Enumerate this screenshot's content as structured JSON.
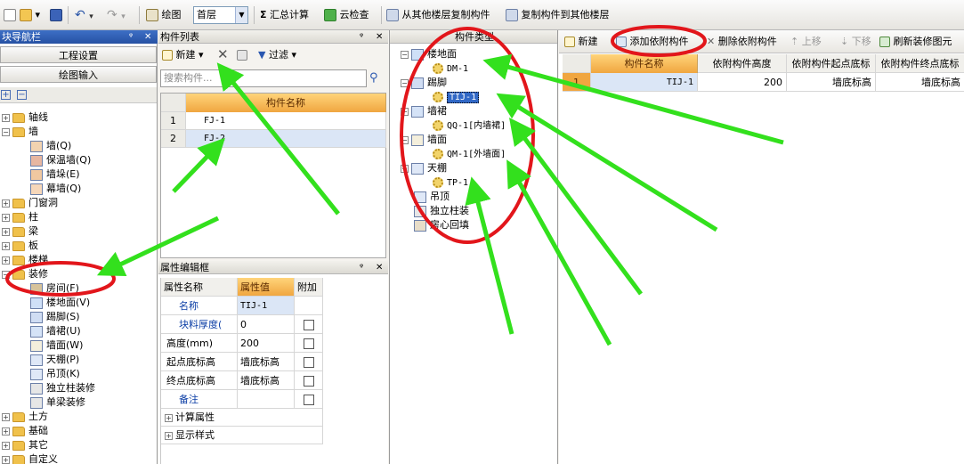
{
  "toolbar": {
    "draw_label": "绘图",
    "floor_value": "首层",
    "sum_label": "汇总计算",
    "cloud_check_label": "云检查",
    "copy_from_label": "从其他楼层复制构件",
    "copy_to_label": "复制构件到其他楼层"
  },
  "nav": {
    "title": "块导航栏",
    "project_settings": "工程设置",
    "draw_input": "绘图输入",
    "tree": [
      {
        "label": "轴线",
        "level": 0,
        "expander": "+",
        "icon": "folder-icon"
      },
      {
        "label": "墙",
        "level": 0,
        "expander": "-",
        "icon": "folder-icon"
      },
      {
        "label": "墙(Q)",
        "level": 1,
        "icon": "wall-icon"
      },
      {
        "label": "保温墙(Q)",
        "level": 1,
        "icon": "insulation-wall-icon"
      },
      {
        "label": "墙垛(E)",
        "level": 1,
        "icon": "wall-pier-icon"
      },
      {
        "label": "幕墙(Q)",
        "level": 1,
        "icon": "curtain-wall-icon"
      },
      {
        "label": "门窗洞",
        "level": 0,
        "expander": "+",
        "icon": "folder-icon"
      },
      {
        "label": "柱",
        "level": 0,
        "expander": "+",
        "icon": "folder-icon"
      },
      {
        "label": "梁",
        "level": 0,
        "expander": "+",
        "icon": "folder-icon"
      },
      {
        "label": "板",
        "level": 0,
        "expander": "+",
        "icon": "folder-icon"
      },
      {
        "label": "楼梯",
        "level": 0,
        "expander": "+",
        "icon": "folder-icon"
      },
      {
        "label": "装修",
        "level": 0,
        "expander": "-",
        "icon": "folder-icon"
      },
      {
        "label": "房间(F)",
        "level": 1,
        "icon": "room-icon"
      },
      {
        "label": "楼地面(V)",
        "level": 1,
        "icon": "floor-icon"
      },
      {
        "label": "踢脚(S)",
        "level": 1,
        "icon": "skirting-icon"
      },
      {
        "label": "墙裙(U)",
        "level": 1,
        "icon": "dado-icon"
      },
      {
        "label": "墙面(W)",
        "level": 1,
        "icon": "wall-surface-icon"
      },
      {
        "label": "天棚(P)",
        "level": 1,
        "icon": "ceiling-icon"
      },
      {
        "label": "吊顶(K)",
        "level": 1,
        "icon": "suspended-ceiling-icon"
      },
      {
        "label": "独立柱装修",
        "level": 1,
        "icon": "column-finish-icon"
      },
      {
        "label": "单梁装修",
        "level": 1,
        "icon": "beam-finish-icon"
      },
      {
        "label": "土方",
        "level": 0,
        "expander": "+",
        "icon": "folder-icon"
      },
      {
        "label": "基础",
        "level": 0,
        "expander": "+",
        "icon": "folder-icon"
      },
      {
        "label": "其它",
        "level": 0,
        "expander": "+",
        "icon": "folder-icon"
      },
      {
        "label": "自定义",
        "level": 0,
        "expander": "+",
        "icon": "folder-icon"
      }
    ]
  },
  "component_list": {
    "title": "构件列表",
    "new_label": "新建",
    "filter_label": "过滤",
    "search_placeholder": "搜索构件...",
    "column_header": "构件名称",
    "rows": [
      {
        "num": "1",
        "name": "FJ-1"
      },
      {
        "num": "2",
        "name": "FJ-2"
      }
    ]
  },
  "property_editor": {
    "title": "属性编辑框",
    "headers": [
      "属性名称",
      "属性值",
      "附加"
    ],
    "rows": [
      {
        "name": "名称",
        "value": "TIJ-1",
        "blue": true,
        "check": false
      },
      {
        "name": "块料厚度(",
        "value": "0",
        "blue": true,
        "check": true
      },
      {
        "name": "高度(mm)",
        "value": "200",
        "blue": false,
        "check": true
      },
      {
        "name": "起点底标高",
        "value": "墙底标高",
        "blue": false,
        "check": true
      },
      {
        "name": "终点底标高",
        "value": "墙底标高",
        "blue": false,
        "check": true
      },
      {
        "name": "备注",
        "value": "",
        "blue": true,
        "check": true
      }
    ],
    "groups": [
      "计算属性",
      "显示样式"
    ]
  },
  "component_type": {
    "title": "构件类型",
    "tree": [
      {
        "label": "楼地面",
        "level": 0,
        "expander": "-",
        "icon": "floor-icon"
      },
      {
        "label": "DM-1",
        "level": 1,
        "icon": "gear-icon"
      },
      {
        "label": "踢脚",
        "level": 0,
        "expander": "-",
        "icon": "skirting-icon"
      },
      {
        "label": "TIJ-1",
        "level": 1,
        "icon": "gear-icon",
        "selected": true
      },
      {
        "label": "墙裙",
        "level": 0,
        "expander": "-",
        "icon": "dado-icon"
      },
      {
        "label": "QQ-1[内墙裙]",
        "level": 1,
        "icon": "gear-icon"
      },
      {
        "label": "墙面",
        "level": 0,
        "expander": "-",
        "icon": "wall-surface-icon"
      },
      {
        "label": "QM-1[外墙面]",
        "level": 1,
        "icon": "gear-icon"
      },
      {
        "label": "天棚",
        "level": 0,
        "expander": "-",
        "icon": "ceiling-icon"
      },
      {
        "label": "TP-1",
        "level": 1,
        "icon": "gear-icon"
      },
      {
        "label": "吊顶",
        "level": 0,
        "icon": "suspended-ceiling-icon"
      },
      {
        "label": "独立柱装",
        "level": 0,
        "icon": "column-finish-icon"
      },
      {
        "label": "房心回填",
        "level": 0,
        "icon": "backfill-icon"
      }
    ]
  },
  "attached": {
    "new_label": "新建",
    "add_label": "添加依附构件",
    "delete_label": "删除依附构件",
    "up_label": "上移",
    "down_label": "下移",
    "refresh_label": "刷新装修图元",
    "headers": [
      "构件名称",
      "依附构件高度",
      "依附构件起点底标",
      "依附构件终点底标"
    ],
    "rows": [
      {
        "num": "1",
        "name": "TIJ-1",
        "height": "200",
        "start": "墙底标高",
        "end": "墙底标高"
      }
    ]
  },
  "colors": {
    "title_blue": "#2651a3",
    "header_orange": "#f0a640",
    "annotation_red": "#e2161b",
    "annotation_green": "#33e01d"
  }
}
